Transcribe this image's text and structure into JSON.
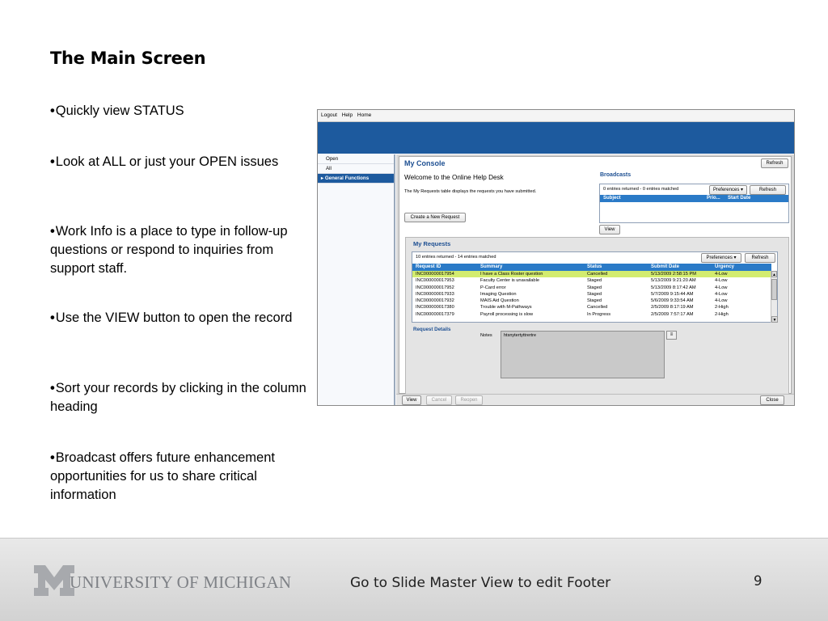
{
  "slide": {
    "title": "The Main Screen",
    "bullets": [
      "Quickly view STATUS",
      "Look at ALL or just your OPEN issues",
      "Work Info is a place to type in follow-up questions or respond to inquiries from support staff.",
      "Use the VIEW button to open the record",
      "Sort your records by clicking in the column heading",
      "Broadcast offers future enhancement opportunities for us to share critical information"
    ],
    "bullet_glyph": "•"
  },
  "screenshot": {
    "menu": [
      "Logout",
      "Help",
      "Home"
    ],
    "nav": [
      "Open",
      "All",
      "General Functions"
    ],
    "console_title": "My Console",
    "refresh_label": "Refresh",
    "welcome": "Welcome to the Online Help Desk",
    "description": "The My Requests table displays the requests you have submitted.",
    "create_button": "Create a New Request",
    "broadcasts": {
      "title": "Broadcasts",
      "count": "0 entries returned - 0 entries matched",
      "preferences": "Preferences",
      "refresh": "Refresh",
      "columns": [
        "Subject",
        "Prio...",
        "Start Date"
      ],
      "view_button": "View"
    },
    "my_requests": {
      "title": "My Requests",
      "count": "10 entries returned - 14 entries matched",
      "preferences": "Preferences",
      "refresh": "Refresh",
      "columns": [
        "Request ID",
        "Summary",
        "Status",
        "Submit Date",
        "Urgency"
      ],
      "rows": [
        [
          "INC000000017954",
          "I have a Class Roster question",
          "Cancelled",
          "5/13/2009 2:58:15 PM",
          "4-Low"
        ],
        [
          "INC000000017953",
          "Faculty Center is unavailable",
          "Staged",
          "5/13/2009 9:21:20 AM",
          "4-Low"
        ],
        [
          "INC000000017952",
          "P-Card error",
          "Staged",
          "5/13/2009 8:17:42 AM",
          "4-Low"
        ],
        [
          "INC000000017933",
          "Imaging Question",
          "Staged",
          "5/7/2009 9:15:44 AM",
          "4-Low"
        ],
        [
          "INC000000017932",
          "MAIS Aid Question",
          "Staged",
          "5/6/2009 9:33:54 AM",
          "4-Low"
        ],
        [
          "INC000000017380",
          "Trouble with M-Pathways",
          "Cancelled",
          "2/5/2009 8:17:19 AM",
          "2-High"
        ],
        [
          "INC000000017379",
          "Payroll processing is slow",
          "In Progress",
          "2/5/2009 7:57:17 AM",
          "2-High"
        ]
      ]
    },
    "request_details": {
      "title": "Request Details",
      "notes_label": "Notes",
      "notes_value": "htsnytertyttrertre"
    },
    "bottom_buttons": [
      "View",
      "Cancel",
      "Reopen"
    ],
    "close_button": "Close"
  },
  "footer": {
    "logo_text": "UNIVERSITY OF MICHIGAN",
    "text": "Go to Slide Master View to edit Footer",
    "page_number": "9"
  }
}
